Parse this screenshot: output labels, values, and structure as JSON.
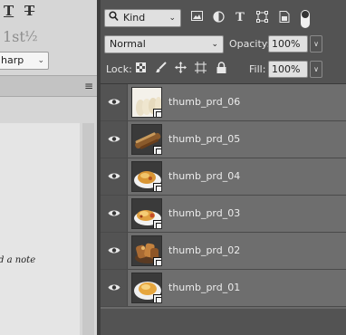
{
  "left_panel": {
    "first_glyph": "1st",
    "half_glyph": "½",
    "underline_glyph": "T",
    "strike_glyph": "T",
    "antialias_value": "harp",
    "panel_menu": "≡",
    "note_text": "d a note"
  },
  "layers_panel": {
    "filter": {
      "kind_label": "Kind",
      "icons": [
        "pixel-layer-filter-icon",
        "adjustment-layer-filter-icon",
        "type-layer-filter-icon",
        "shape-layer-filter-icon",
        "smart-object-filter-icon",
        "filter-toggle-icon"
      ]
    },
    "blend_mode": "Normal",
    "opacity_label": "Opacity:",
    "opacity_value": "100%",
    "lock_label": "Lock:",
    "lock_icons": [
      "lock-transparent-pixels-icon",
      "lock-image-pixels-icon",
      "lock-position-icon",
      "lock-artboard-icon",
      "lock-all-icon"
    ],
    "fill_label": "Fill:",
    "fill_value": "100%",
    "layers": [
      {
        "name": "thumb_prd_06"
      },
      {
        "name": "thumb_prd_05"
      },
      {
        "name": "thumb_prd_04"
      },
      {
        "name": "thumb_prd_03"
      },
      {
        "name": "thumb_prd_02"
      },
      {
        "name": "thumb_prd_01"
      }
    ]
  },
  "colors": {
    "panel_bg": "#535353",
    "layer_row_bg": "#6e6e6e",
    "left_panel_bg": "#d6d6d6"
  }
}
